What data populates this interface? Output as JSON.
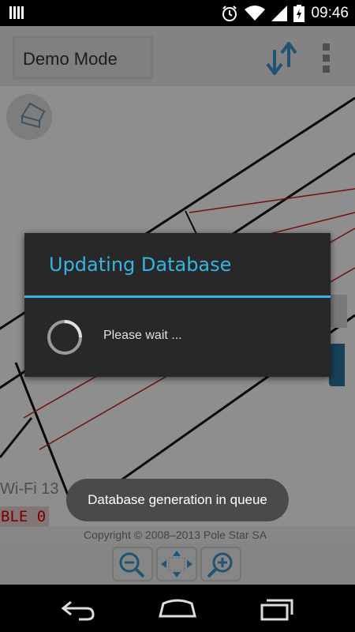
{
  "status_bar": {
    "time": "09:46",
    "icons": [
      "notification-bars-icon",
      "alarm-icon",
      "wifi-icon",
      "signal-icon",
      "battery-charging-icon"
    ]
  },
  "action_bar": {
    "mode_label": "Demo Mode",
    "sync_icon": "sync-arrows-icon",
    "overflow_icon": "overflow-menu-icon"
  },
  "map": {
    "wifi_text": "Wi-Fi  13",
    "ble_text": "BLE  0",
    "copyright": "Copyright © 2008–2013 Pole Star SA"
  },
  "zoom_controls": {
    "icons": [
      "zoom-out-icon",
      "pan-icon",
      "zoom-in-icon"
    ]
  },
  "dialog": {
    "title": "Updating Database",
    "message": "Please wait ..."
  },
  "toast": {
    "message": "Database generation in queue"
  },
  "nav_bar": {
    "icons": [
      "back-icon",
      "home-icon",
      "recents-icon"
    ]
  },
  "colors": {
    "accent": "#33b5e5",
    "dialog_bg": "#282828",
    "ble_text": "#d30000"
  }
}
